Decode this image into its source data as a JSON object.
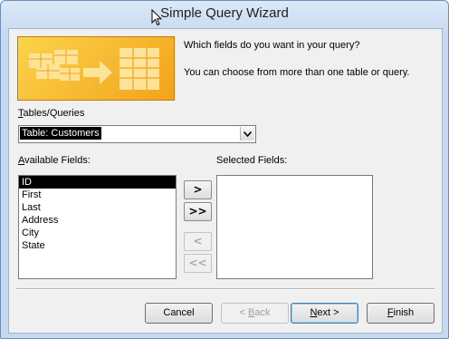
{
  "window": {
    "title": "Simple Query Wizard"
  },
  "instructions": {
    "question": "Which fields do you want in your query?",
    "hint": "You can choose from more than one table or query."
  },
  "tables_queries": {
    "label_accel": "T",
    "label_rest": "ables/Queries",
    "selected": "Table: Customers"
  },
  "available_fields": {
    "label_accel": "A",
    "label_rest": "vailable Fields:",
    "items": [
      "ID",
      "First",
      "Last",
      "Address",
      "City",
      "State"
    ],
    "selected_index": 0
  },
  "selected_fields": {
    "label": "Selected Fields:",
    "items": []
  },
  "move_buttons": {
    "add_one": ">",
    "add_all": ">>",
    "remove_one": "<",
    "remove_all": "<<"
  },
  "buttons": {
    "cancel": "Cancel",
    "back_prefix": "< ",
    "back_accel": "B",
    "back_rest": "ack",
    "next_accel": "N",
    "next_rest": "ext >",
    "finish_accel": "F",
    "finish_rest": "inish"
  },
  "colors": {
    "banner": "#f7b52c",
    "selection": "#000000"
  }
}
